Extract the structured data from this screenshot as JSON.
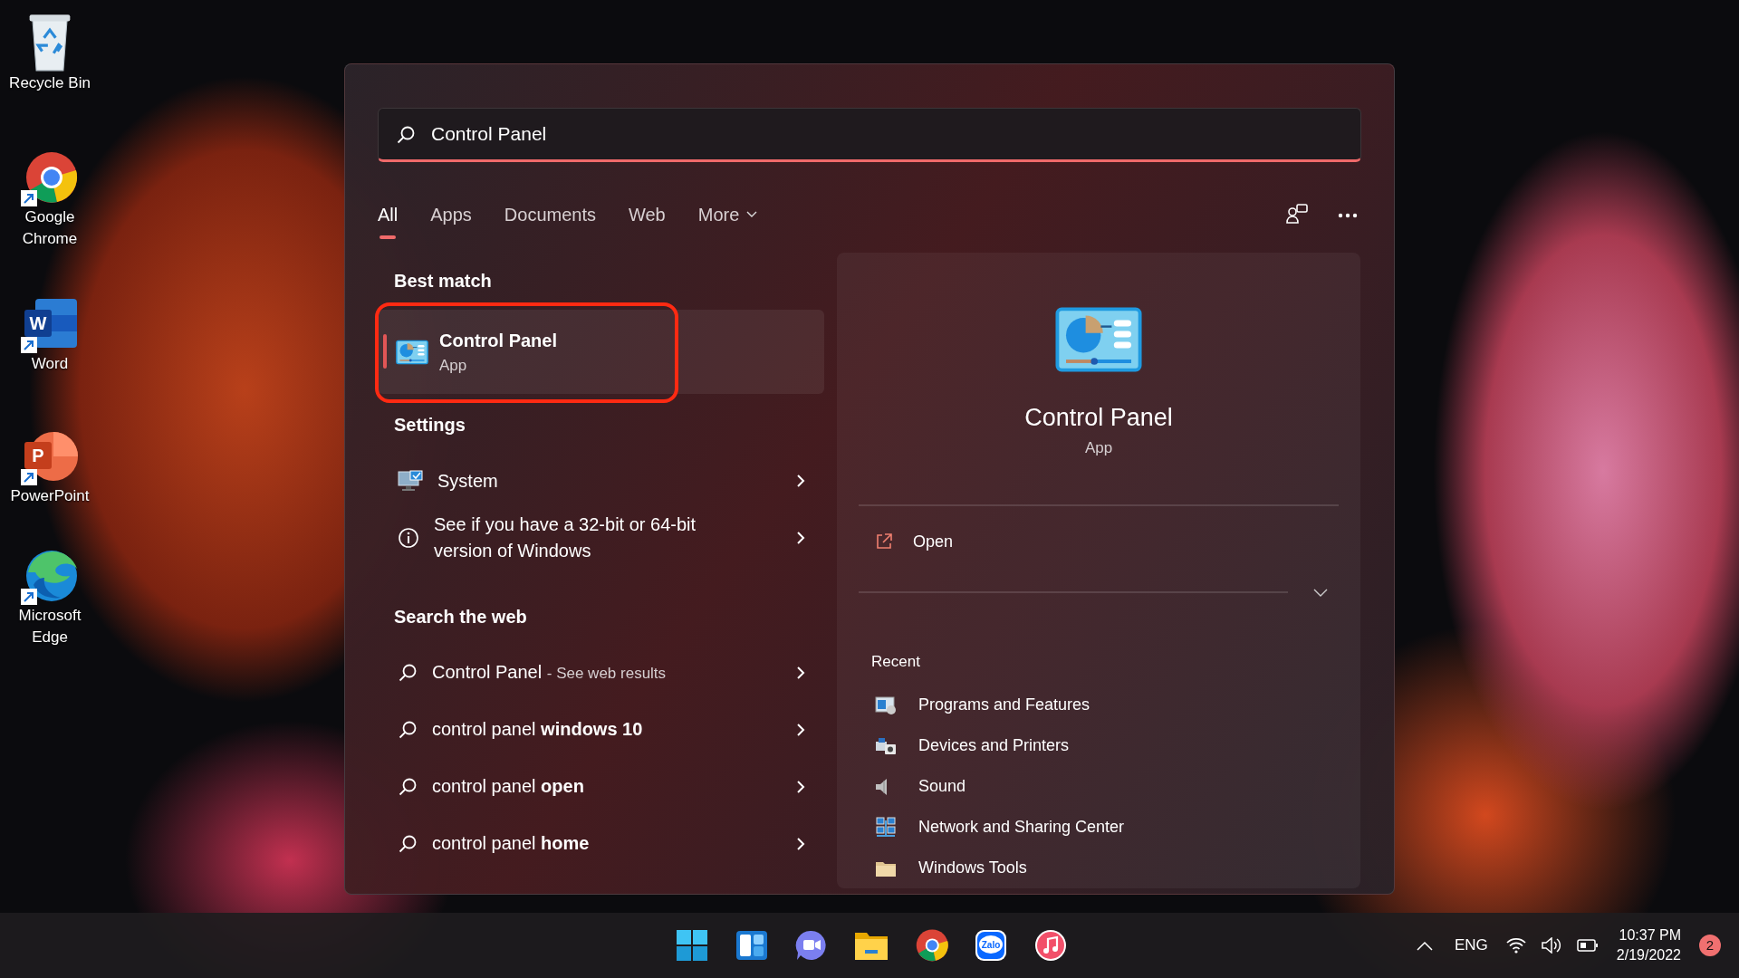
{
  "desktop_icons": [
    {
      "label": "Recycle Bin",
      "kind": "recycle",
      "shortcut": false
    },
    {
      "label": "Google Chrome",
      "kind": "chrome",
      "shortcut": true
    },
    {
      "label": "Word",
      "kind": "word",
      "glyph": "W",
      "shortcut": true
    },
    {
      "label": "PowerPoint",
      "kind": "powerpoint",
      "glyph": "P",
      "shortcut": true
    },
    {
      "label": "Microsoft Edge",
      "kind": "edge",
      "shortcut": true
    }
  ],
  "search": {
    "value": "Control Panel"
  },
  "tabs": [
    {
      "label": "All",
      "selected": true
    },
    {
      "label": "Apps",
      "selected": false
    },
    {
      "label": "Documents",
      "selected": false
    },
    {
      "label": "Web",
      "selected": false
    },
    {
      "label": "More",
      "selected": false,
      "dropdown": true
    }
  ],
  "best_match": {
    "heading": "Best match",
    "title": "Control Panel",
    "subtitle": "App",
    "selected": true,
    "annotated": true
  },
  "settings": {
    "heading": "Settings",
    "items": [
      {
        "kind": "system",
        "text": "System"
      },
      {
        "kind": "info",
        "text": "See if you have a 32-bit or 64-bit version of Windows"
      }
    ]
  },
  "web": {
    "heading": "Search the web",
    "items": [
      {
        "text": "Control Panel",
        "hint": "- See web results"
      },
      {
        "text": "control panel **windows 10**"
      },
      {
        "text": "control panel **open**"
      },
      {
        "text": "control panel **home**"
      }
    ]
  },
  "preview": {
    "title": "Control Panel",
    "subtitle": "App",
    "actions": [
      {
        "label": "Open"
      }
    ],
    "recent_heading": "Recent",
    "recent": [
      {
        "label": "Programs and Features",
        "kind": "programs"
      },
      {
        "label": "Devices and Printers",
        "kind": "devices"
      },
      {
        "label": "Sound",
        "kind": "sound"
      },
      {
        "label": "Network and Sharing Center",
        "kind": "network"
      },
      {
        "label": "Windows Tools",
        "kind": "folder"
      }
    ]
  },
  "taskbar": {
    "apps": [
      {
        "kind": "start"
      },
      {
        "kind": "widgets"
      },
      {
        "kind": "chat"
      },
      {
        "kind": "explorer"
      },
      {
        "kind": "chrome"
      },
      {
        "kind": "zalo",
        "logo_text": "Zalo"
      },
      {
        "kind": "music"
      }
    ],
    "language": "ENG",
    "time": "10:37 PM",
    "date": "2/19/2022",
    "notifications": "2"
  }
}
